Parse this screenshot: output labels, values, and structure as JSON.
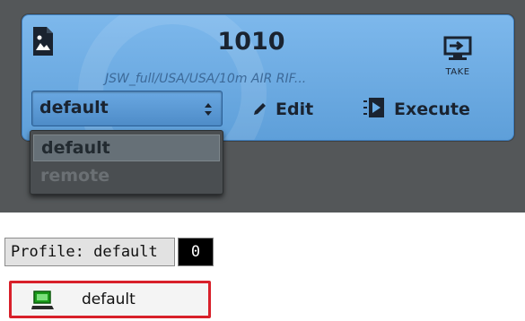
{
  "card": {
    "title": "1010",
    "subtitle": "JSW_full/USA/USA/10m AIR RIF...",
    "take_label": "TAKE",
    "selected_profile": "default",
    "edit_label": "Edit",
    "execute_label": "Execute"
  },
  "dropdown": {
    "options": [
      {
        "label": "default",
        "selected": true
      },
      {
        "label": "remote",
        "selected": false
      }
    ]
  },
  "status": {
    "profile_text": "Profile: default",
    "count": "0"
  },
  "profile_item": {
    "label": "default"
  },
  "colors": {
    "card_blue": "#6aaee8",
    "panel_dark": "#545759",
    "highlight_red": "#d8202a",
    "computer_green": "#1a9a1a"
  }
}
